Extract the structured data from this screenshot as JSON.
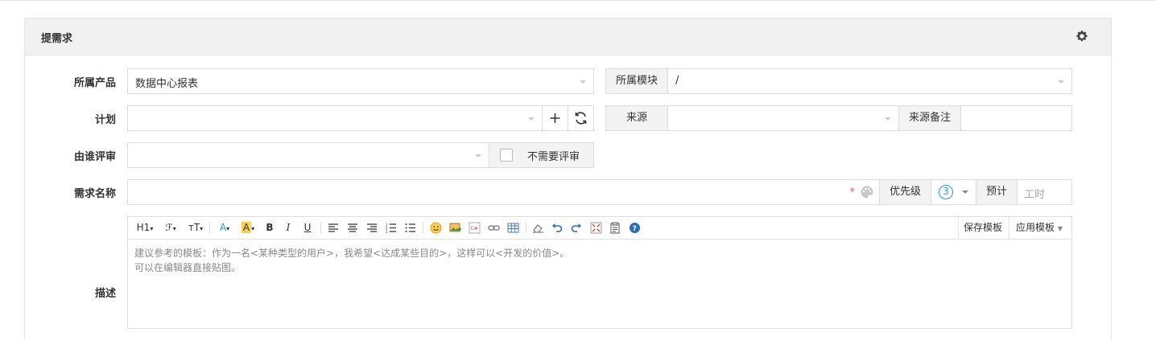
{
  "panel": {
    "title": "提需求",
    "settings_icon": "gear-icon"
  },
  "form": {
    "product": {
      "label": "所属产品",
      "value": "数据中心报表"
    },
    "module": {
      "label": "所属模块",
      "value": "/"
    },
    "plan": {
      "label": "计划",
      "value": "",
      "add_icon": "plus-icon",
      "refresh_icon": "refresh-icon"
    },
    "source": {
      "label": "来源",
      "value": ""
    },
    "source_note": {
      "label": "来源备注",
      "value": ""
    },
    "reviewer": {
      "label": "由谁评审",
      "value": "",
      "no_review_label": "不需要评审"
    },
    "title": {
      "label": "需求名称",
      "value": "",
      "required_mark": "*",
      "color_icon": "palette-icon"
    },
    "priority": {
      "label": "优先级",
      "value": "3"
    },
    "estimate": {
      "label": "预计",
      "placeholder": "工时"
    },
    "description": {
      "label": "描述",
      "placeholder_line1": "建议参考的模板：作为一名<某种类型的用户>，我希望<达成某些目的>，这样可以<开发的价值>。",
      "placeholder_line2": "可以在编辑器直接贴图。"
    }
  },
  "editor_toolbar": {
    "items": [
      "H1",
      "ℱ",
      "тT",
      "A",
      "A",
      "B",
      "I",
      "U"
    ],
    "save_template": "保存模板",
    "apply_template": "应用模板"
  },
  "colors": {
    "required": "#e85a5a",
    "priority_ring": "#1c9bd9",
    "accent_yellow": "#ffd24d"
  }
}
